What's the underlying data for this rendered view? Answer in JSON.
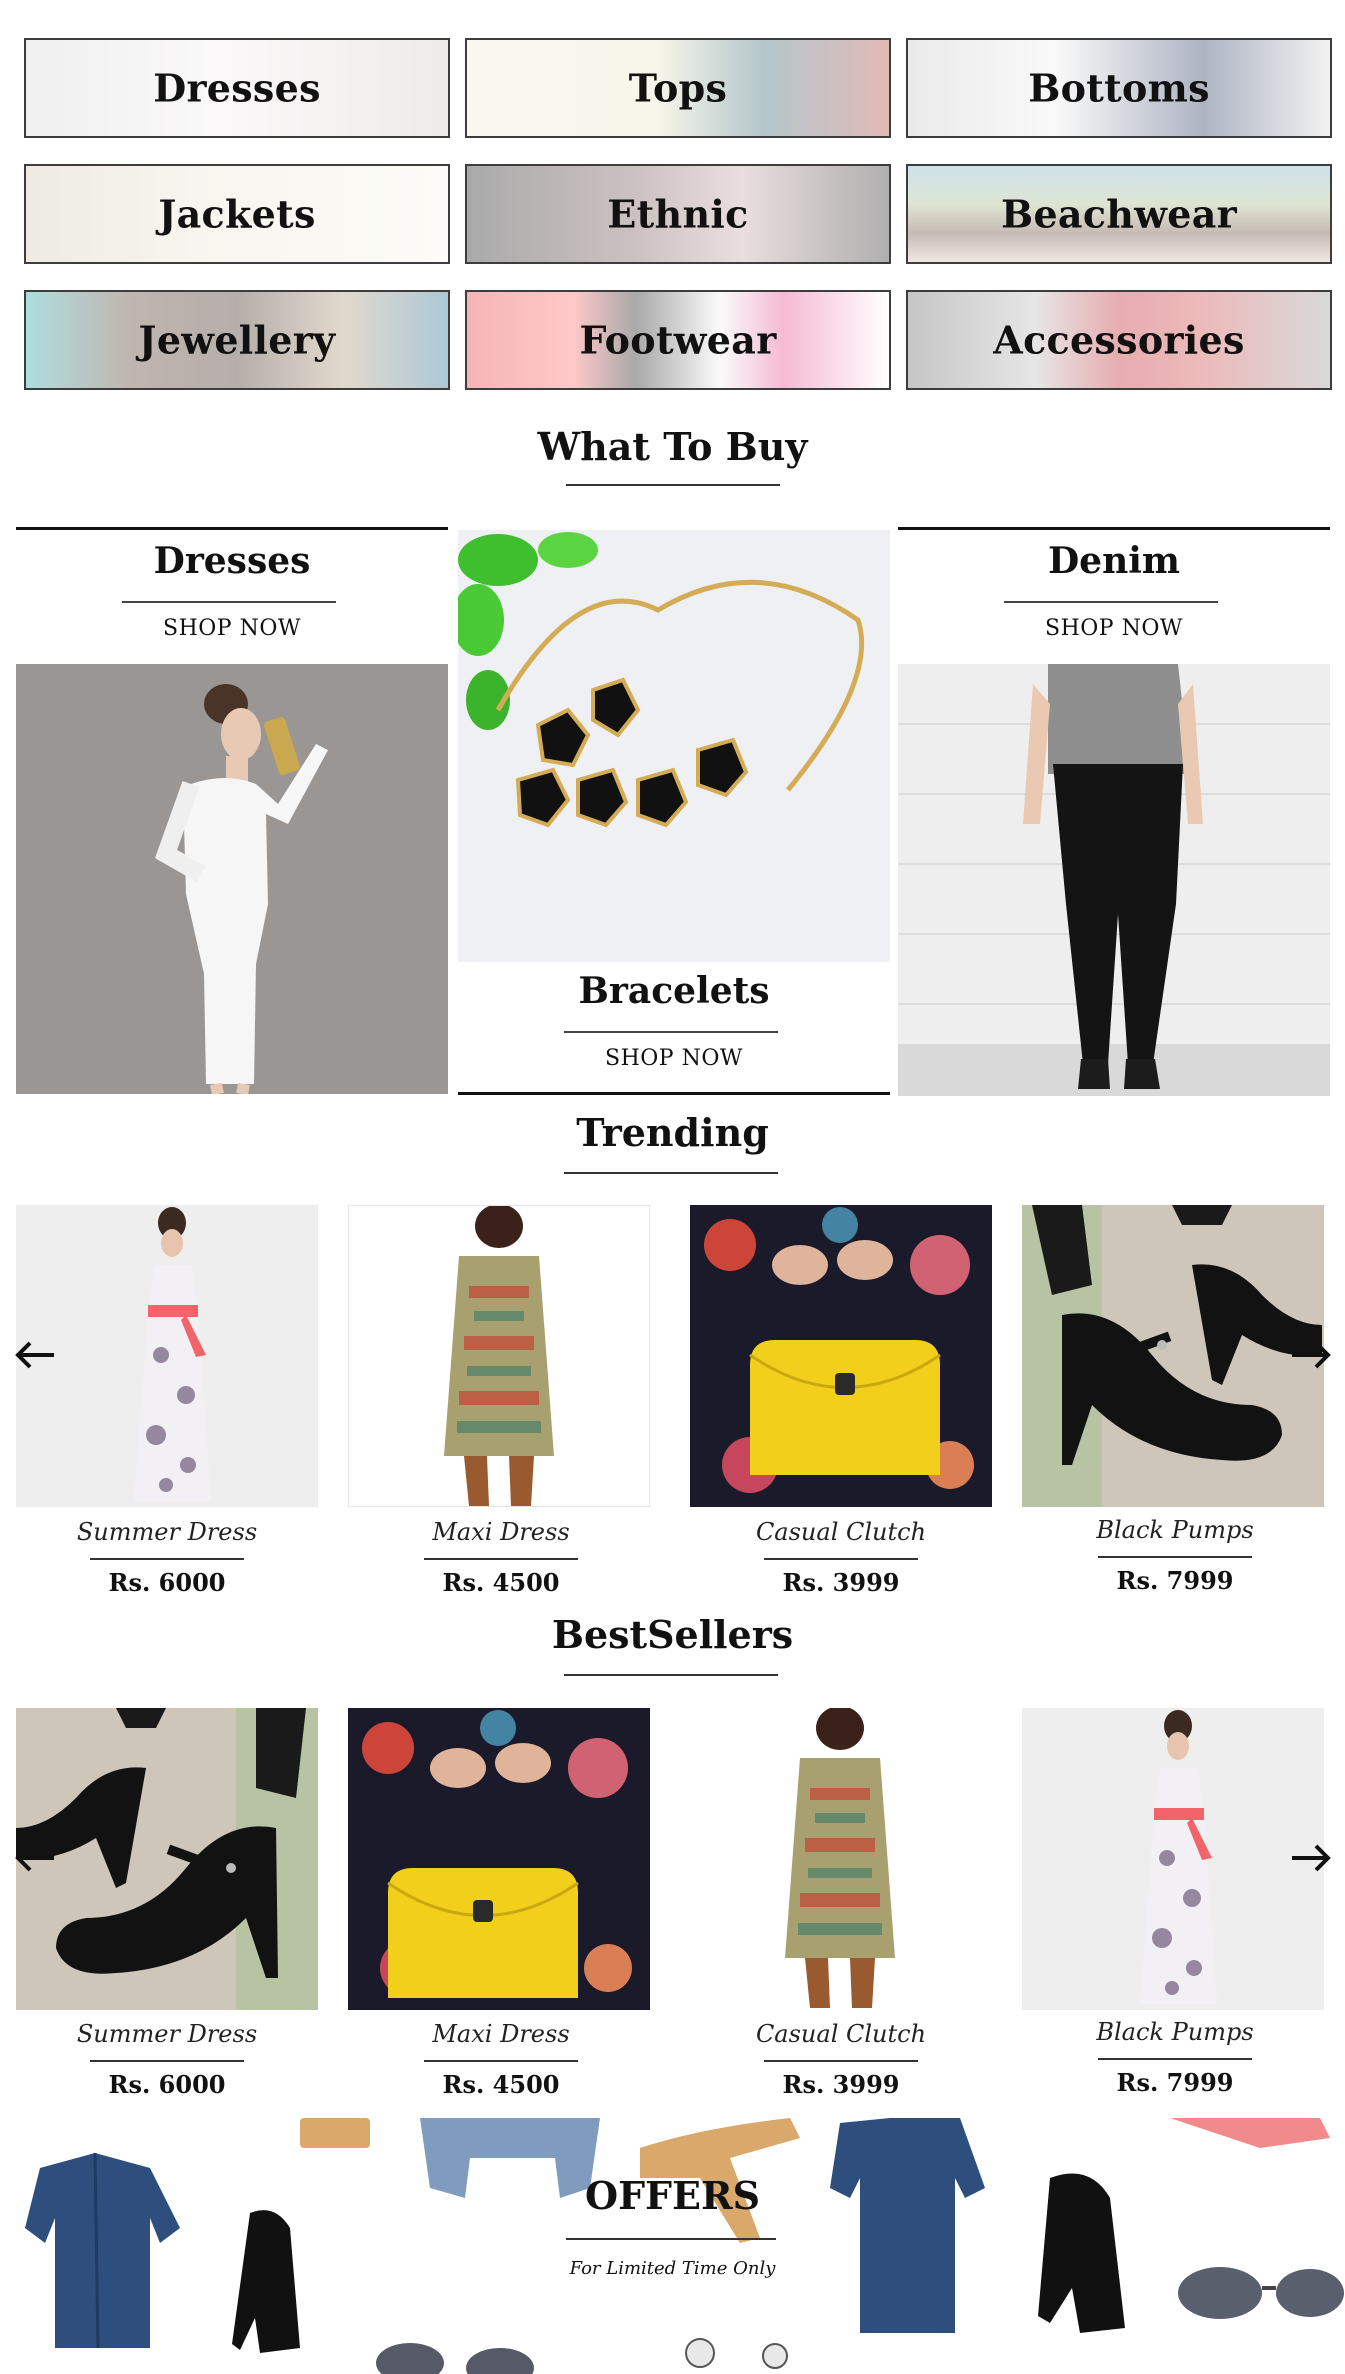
{
  "categories": [
    {
      "label": "Dresses"
    },
    {
      "label": "Tops"
    },
    {
      "label": "Bottoms"
    },
    {
      "label": "Jackets"
    },
    {
      "label": "Ethnic"
    },
    {
      "label": "Beachwear"
    },
    {
      "label": "Jewellery"
    },
    {
      "label": "Footwear"
    },
    {
      "label": "Accessories"
    }
  ],
  "what_to_buy": {
    "title": "What To Buy",
    "items": [
      {
        "title": "Dresses",
        "cta": "SHOP NOW"
      },
      {
        "title": "Bracelets",
        "cta": "SHOP NOW"
      },
      {
        "title": "Denim",
        "cta": "SHOP NOW"
      }
    ]
  },
  "trending": {
    "title": "Trending",
    "products": [
      {
        "name": "Summer Dress",
        "price": "Rs. 6000"
      },
      {
        "name": "Maxi Dress",
        "price": "Rs. 4500"
      },
      {
        "name": "Casual Clutch",
        "price": "Rs. 3999"
      },
      {
        "name": "Black Pumps",
        "price": "Rs. 7999"
      }
    ]
  },
  "bestsellers": {
    "title": "BestSellers",
    "products": [
      {
        "name": "Summer Dress",
        "price": "Rs. 6000"
      },
      {
        "name": "Maxi Dress",
        "price": "Rs. 4500"
      },
      {
        "name": "Casual Clutch",
        "price": "Rs. 3999"
      },
      {
        "name": "Black Pumps",
        "price": "Rs. 7999"
      }
    ]
  },
  "offers": {
    "title": "OFFERS",
    "subtitle": "For Limited Time Only"
  },
  "colors": {
    "rule": "#333333",
    "clutch_yellow": "#f2cf1a",
    "belt_pink": "#f26464",
    "denim_blue": "#2e4e7e"
  },
  "icons": [
    "arrow-left-icon",
    "arrow-right-icon"
  ]
}
